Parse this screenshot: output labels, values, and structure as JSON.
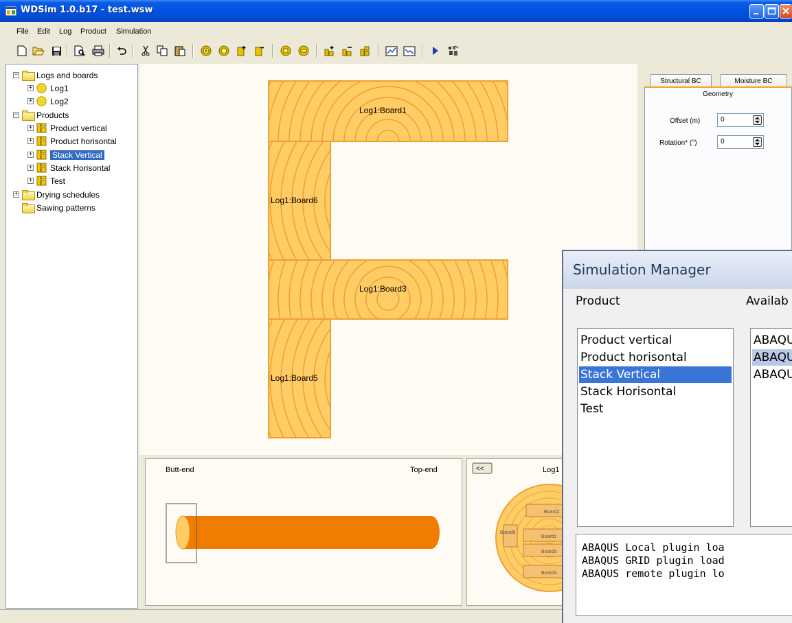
{
  "window": {
    "title": "WDSim 1.0.b17 - test.wsw"
  },
  "menu": [
    "File",
    "Edit",
    "Log",
    "Product",
    "Simulation"
  ],
  "tree": {
    "logs_root": "Logs and boards",
    "logs": [
      "Log1",
      "Log2"
    ],
    "products_root": "Products",
    "products": [
      "Product vertical",
      "Product horisontal",
      "Stack Vertical",
      "Stack Horisontal",
      "Test"
    ],
    "selected_product": "Stack Vertical",
    "drying": "Drying schedules",
    "sawing": "Sawing patterns"
  },
  "canvas": {
    "boards": [
      "Log1:Board1",
      "Log1:Board6",
      "Log1:Board3",
      "Log1:Board5"
    ]
  },
  "log_view": {
    "butt_end": "Butt-end",
    "top_end": "Top-end"
  },
  "log_section": {
    "back_button": "<<",
    "log_name": "Log1",
    "boards": [
      "Board2",
      "Board6",
      "Board1",
      "Board3",
      "Board4"
    ]
  },
  "props": {
    "tabs": [
      "Structural BC",
      "Moisture BC",
      "Geometry"
    ],
    "offset_label": "Offset (m)",
    "offset_value": "0",
    "rotation_label": "Rotation* (°)",
    "rotation_value": "0"
  },
  "sim_manager": {
    "title": "Simulation Manager",
    "product_label": "Product",
    "available_label": "Availab",
    "products": [
      "Product vertical",
      "Product horisontal",
      "Stack Vertical",
      "Stack Horisontal",
      "Test"
    ],
    "selected": "Stack Vertical",
    "available": [
      "ABAQU",
      "ABAQU",
      "ABAQU"
    ],
    "log": [
      "ABAQUS Local plugin loa",
      "ABAQUS GRID plugin load",
      "ABAQUS remote plugin lo"
    ]
  },
  "colors": {
    "wood": "#ffcc66",
    "ring": "#f0a030",
    "log_body": "#f07d00",
    "selection": "#316ac5"
  }
}
